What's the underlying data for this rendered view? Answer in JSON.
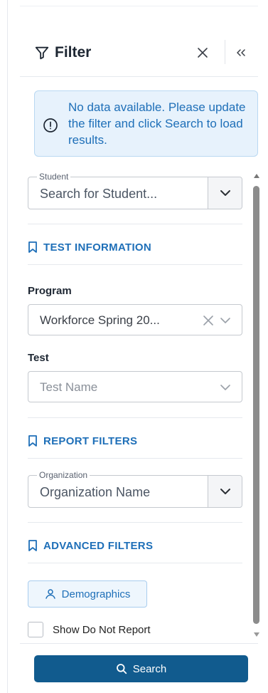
{
  "header": {
    "title": "Filter"
  },
  "alert": {
    "message": "No data available. Please update the filter and click Search to load results."
  },
  "student": {
    "label": "Student",
    "placeholder": "Search for Student..."
  },
  "sections": {
    "test_information": "TEST INFORMATION",
    "report_filters": "REPORT FILTERS",
    "advanced_filters": "ADVANCED FILTERS"
  },
  "program": {
    "label": "Program",
    "value": "Workforce Spring 20..."
  },
  "test": {
    "label": "Test",
    "placeholder": "Test Name"
  },
  "organization": {
    "label": "Organization",
    "placeholder": "Organization Name"
  },
  "demographics_button": "Demographics",
  "show_do_not_report": "Show Do Not Report",
  "search_button": "Search",
  "colors": {
    "accent": "#1e6fb8",
    "primary_button": "#115b8e",
    "alert_bg": "#e7f2fc"
  }
}
